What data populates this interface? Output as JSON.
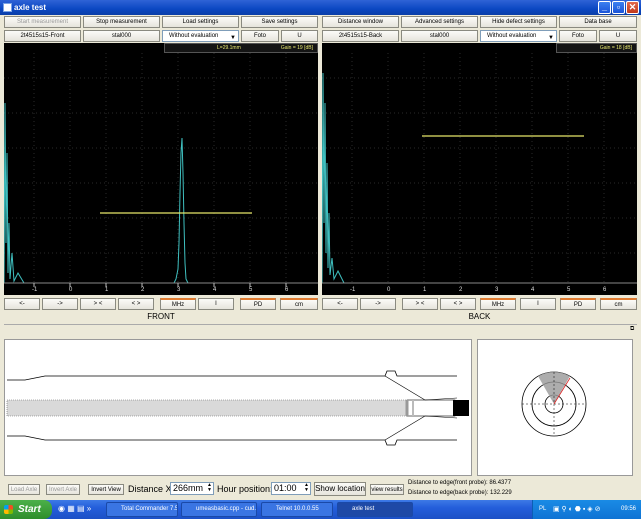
{
  "window": {
    "title": "axle test"
  },
  "toolbar1": [
    "Start measurement",
    "Stop measurement",
    "Load settings",
    "Save settings",
    "Distance window",
    "Advanced settings",
    "Hide defect settings",
    "Data base"
  ],
  "front_row": {
    "probe": "2t4515s15-Front",
    "mat": "stal000",
    "eval": "Without evaluation",
    "foto": "Foto",
    "u": "U"
  },
  "back_row": {
    "probe": "2t4515s15-Back",
    "mat": "stal000",
    "eval": "Without evaluation",
    "foto": "Foto",
    "u": "U"
  },
  "front_scope": {
    "length": "L=29.1mm",
    "gain": "Gain = 19 [dB]",
    "ticks": [
      "-1",
      "0",
      "1",
      "2",
      "3",
      "4",
      "5",
      "6"
    ]
  },
  "back_scope": {
    "gain": "Gain = 18 [dB]",
    "ticks": [
      "-1",
      "0",
      "1",
      "2",
      "3",
      "4",
      "5",
      "6"
    ]
  },
  "front_controls": [
    "<-",
    "->",
    "> <",
    "< >",
    "MHz",
    "I",
    "PD",
    "cm"
  ],
  "back_controls": [
    "<-",
    "->",
    "> <",
    "< >",
    "MHz",
    "I",
    "PD",
    "cm"
  ],
  "labels": {
    "front": "FRONT",
    "back": "BACK"
  },
  "bottom": {
    "load_axle": "Load Axle",
    "invert_axle": "Invert Axle",
    "invert_view": "Invert View",
    "distance_x_label": "Distance X:",
    "distance_x_value": "266mm",
    "hour_label": "Hour position:",
    "hour_value": "01:00",
    "show_location": "Show location",
    "view_results": "view results",
    "dist_front": "Distance to edge(front probe): 86.4377",
    "dist_back": "Distance to edge(back probe): 132.229"
  },
  "taskbar": {
    "start": "Start",
    "tasks": [
      "Total Commander 7.5...",
      "umeasbasic.cpp - cud...",
      "Telnet 10.0.0.55",
      "axle test"
    ],
    "tray_lang": "PL",
    "clock": "09:56"
  }
}
